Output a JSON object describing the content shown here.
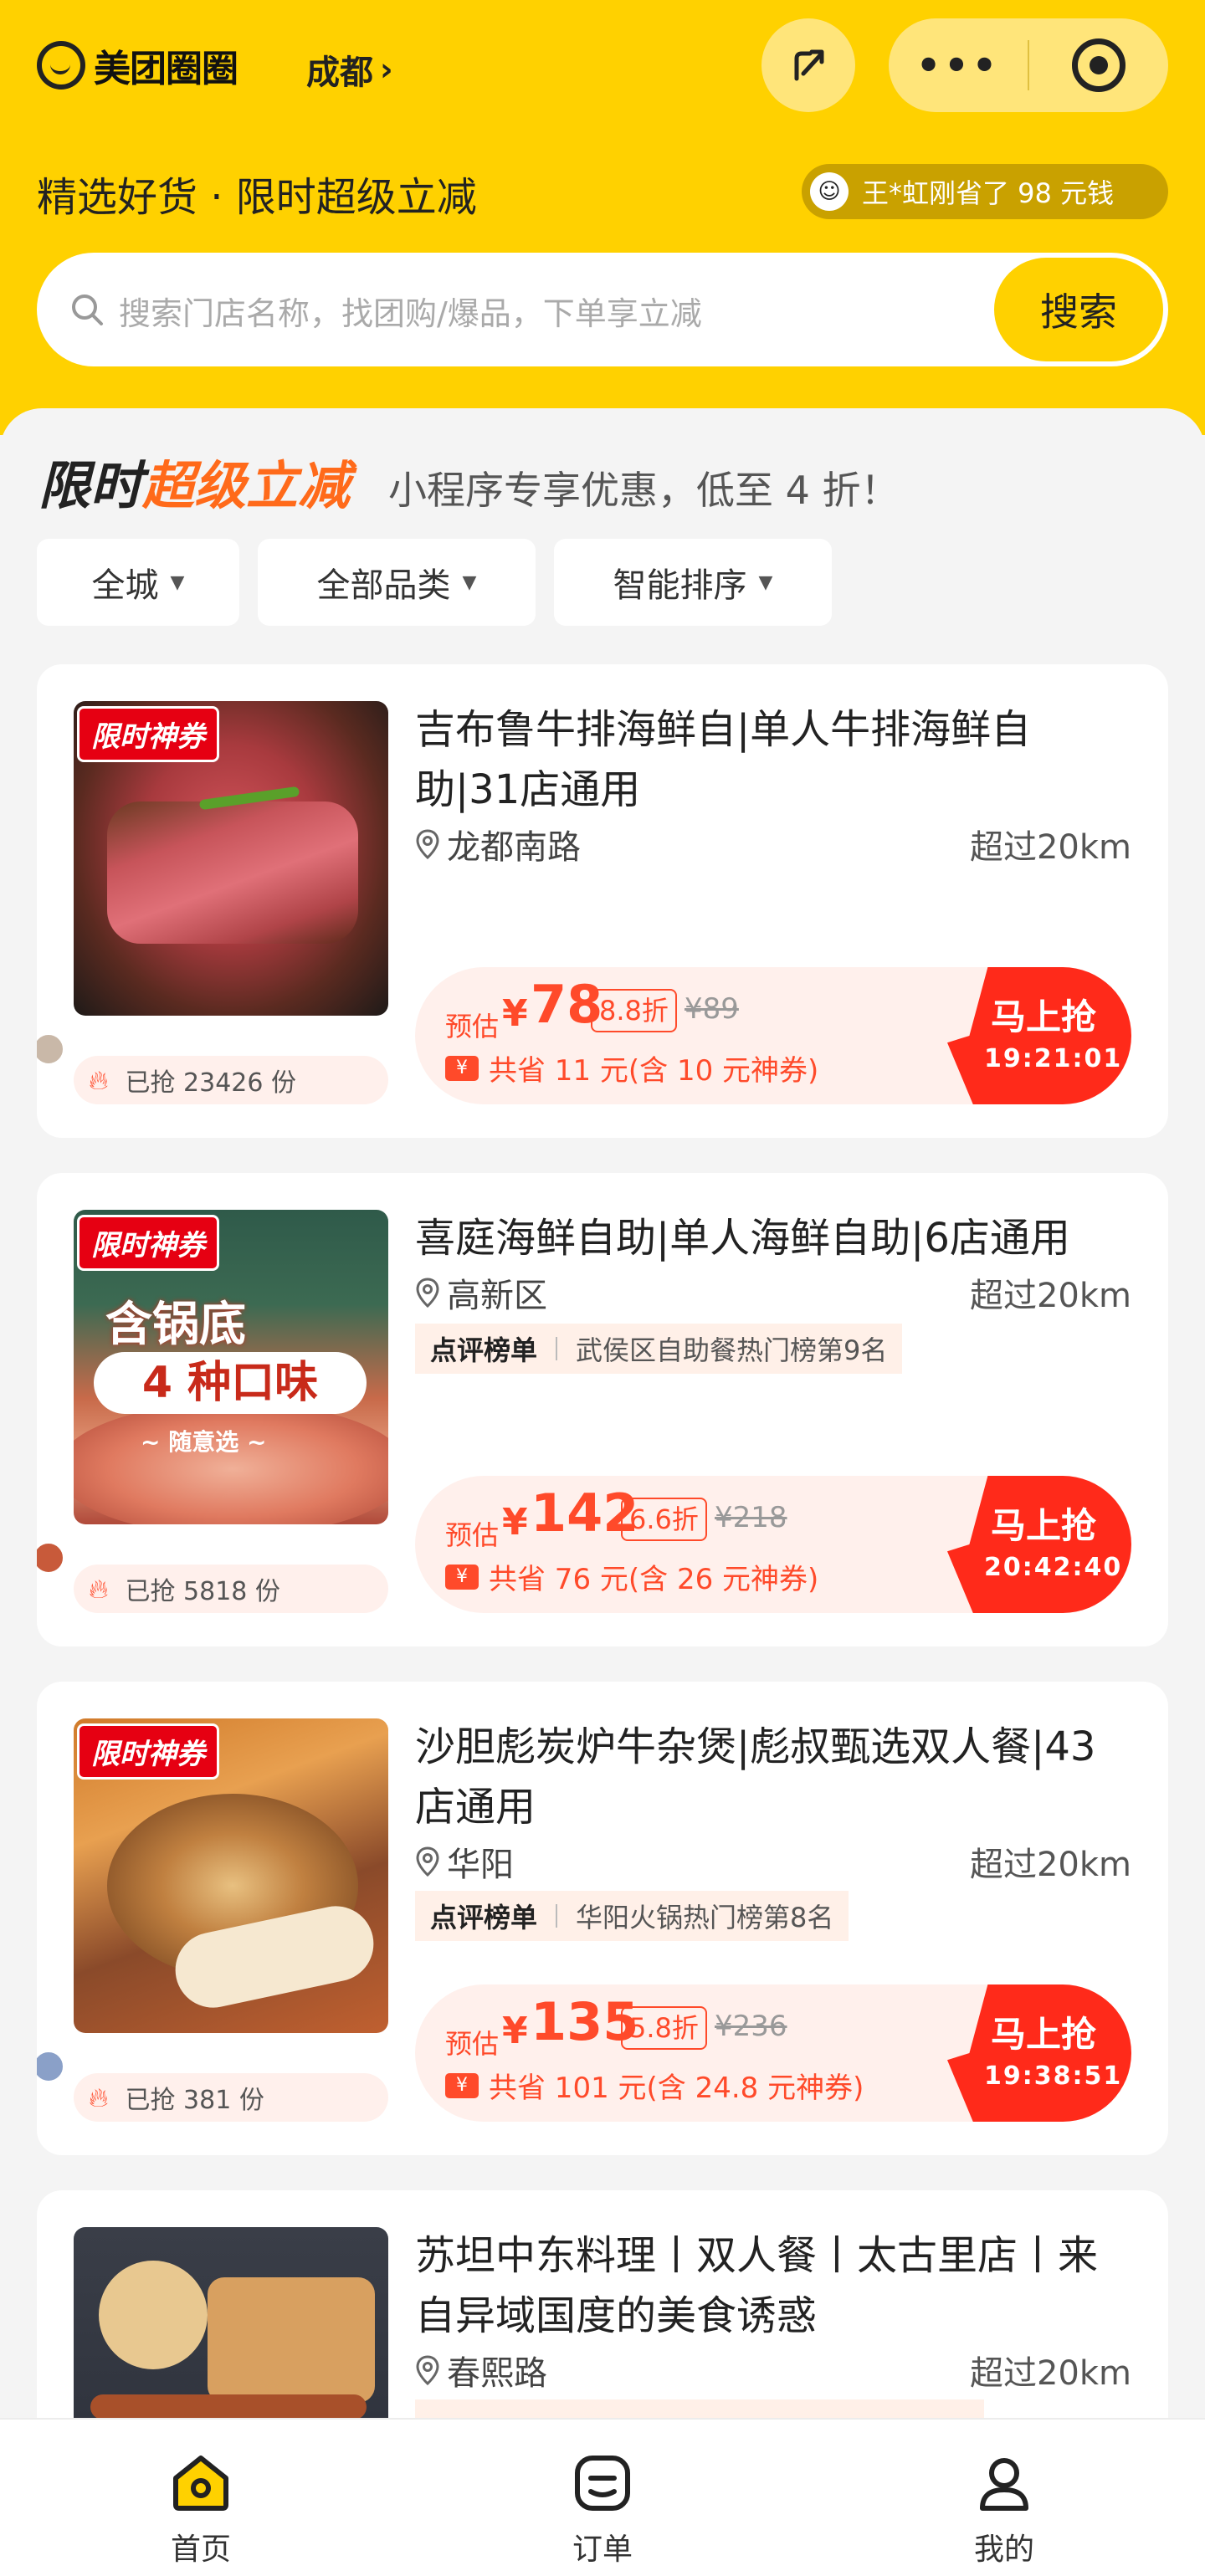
{
  "header": {
    "logo_text": "美团圈圈",
    "city": "成都",
    "tagline": "精选好货 · 限时超级立减",
    "saved_text": "王*虹刚省了 98 元钱",
    "search_placeholder": "搜索门店名称，找团购/爆品，下单享立减",
    "search_button": "搜索"
  },
  "promo": {
    "title_part1": "限时",
    "title_part2": "超级立减",
    "subtitle": "小程序专享优惠，低至 4 折！"
  },
  "filters": [
    "全城",
    "全部品类",
    "智能排序"
  ],
  "deals": [
    {
      "badge": "限时神券",
      "title": "吉布鲁牛排海鲜自|单人牛排海鲜自助|31店通用",
      "location": "龙都南路",
      "distance": "超过20km",
      "rank_label": "",
      "rank_text": "",
      "est_label": "预估",
      "currency": "¥",
      "price": "78",
      "discount": "8.8折",
      "original": "¥89",
      "savings": "共省 11 元(含 10 元神券)",
      "cta": "马上抢",
      "countdown": "19:21:01",
      "grabbed": "已抢 23426 份"
    },
    {
      "badge": "限时神券",
      "title": "喜庭海鲜自助|单人海鲜自助|6店通用",
      "location": "高新区",
      "distance": "超过20km",
      "rank_label": "点评榜单",
      "rank_text": "武侯区自助餐热门榜第9名",
      "est_label": "预估",
      "currency": "¥",
      "price": "142",
      "discount": "6.6折",
      "original": "¥218",
      "savings": "共省 76 元(含 26 元神券)",
      "cta": "马上抢",
      "countdown": "20:42:40",
      "grabbed": "已抢 5818 份",
      "image_text1": "含锅底",
      "image_text2": "4 种口味",
      "image_text3": "~ 随意选 ~"
    },
    {
      "badge": "限时神券",
      "title": "沙胆彪炭炉牛杂煲|彪叔甄选双人餐|43店通用",
      "location": "华阳",
      "distance": "超过20km",
      "rank_label": "点评榜单",
      "rank_text": "华阳火锅热门榜第8名",
      "est_label": "预估",
      "currency": "¥",
      "price": "135",
      "discount": "5.8折",
      "original": "¥236",
      "savings": "共省 101 元(含 24.8 元神券)",
      "cta": "马上抢",
      "countdown": "19:38:51",
      "grabbed": "已抢 381 份"
    },
    {
      "title": "苏坦中东料理丨双人餐丨太古里店丨来自异域国度的美食诱惑",
      "location": "春熙路",
      "distance": "超过20km"
    }
  ],
  "nav": [
    {
      "label": "首页",
      "icon": "home-icon"
    },
    {
      "label": "订单",
      "icon": "order-icon"
    },
    {
      "label": "我的",
      "icon": "profile-icon"
    }
  ],
  "colors": {
    "brand_yellow": "#ffd100",
    "accent_orange": "#ff6a1a",
    "deal_red": "#ff2a1a"
  }
}
